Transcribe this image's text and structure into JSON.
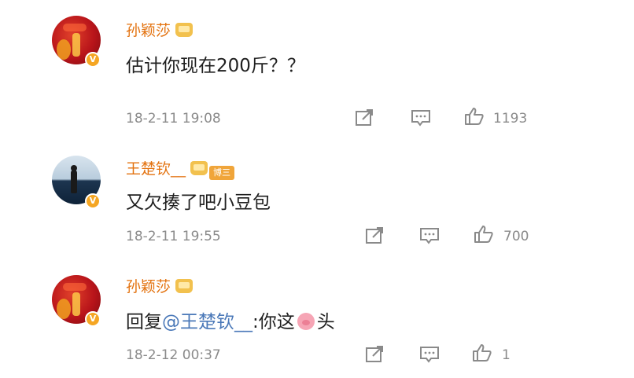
{
  "comments": [
    {
      "username": "孙颖莎",
      "text": "估计你现在200斤？？",
      "time": "18-2-11 19:08",
      "likes": "1193"
    },
    {
      "username": "王楚钦__",
      "badge": "博三",
      "text": "又欠揍了吧小豆包",
      "time": "18-2-11 19:55",
      "likes": "700"
    },
    {
      "username": "孙颖莎",
      "text_prefix": "回复",
      "mention": "@王楚钦__",
      "text_suffix": ":你这",
      "text_end": "头",
      "time": "18-2-12 00:37",
      "likes": "1"
    }
  ],
  "icons": {
    "verified": "verified-v-icon",
    "vip": "crown-icon",
    "repost": "repost-icon",
    "comment": "comment-icon",
    "like": "thumbs-up-icon",
    "emoji": "pig-emoji-icon"
  },
  "colors": {
    "username": "#e3720f",
    "mention": "#4a78b8",
    "meta": "#8a8a8a",
    "verified": "#f5a623"
  }
}
